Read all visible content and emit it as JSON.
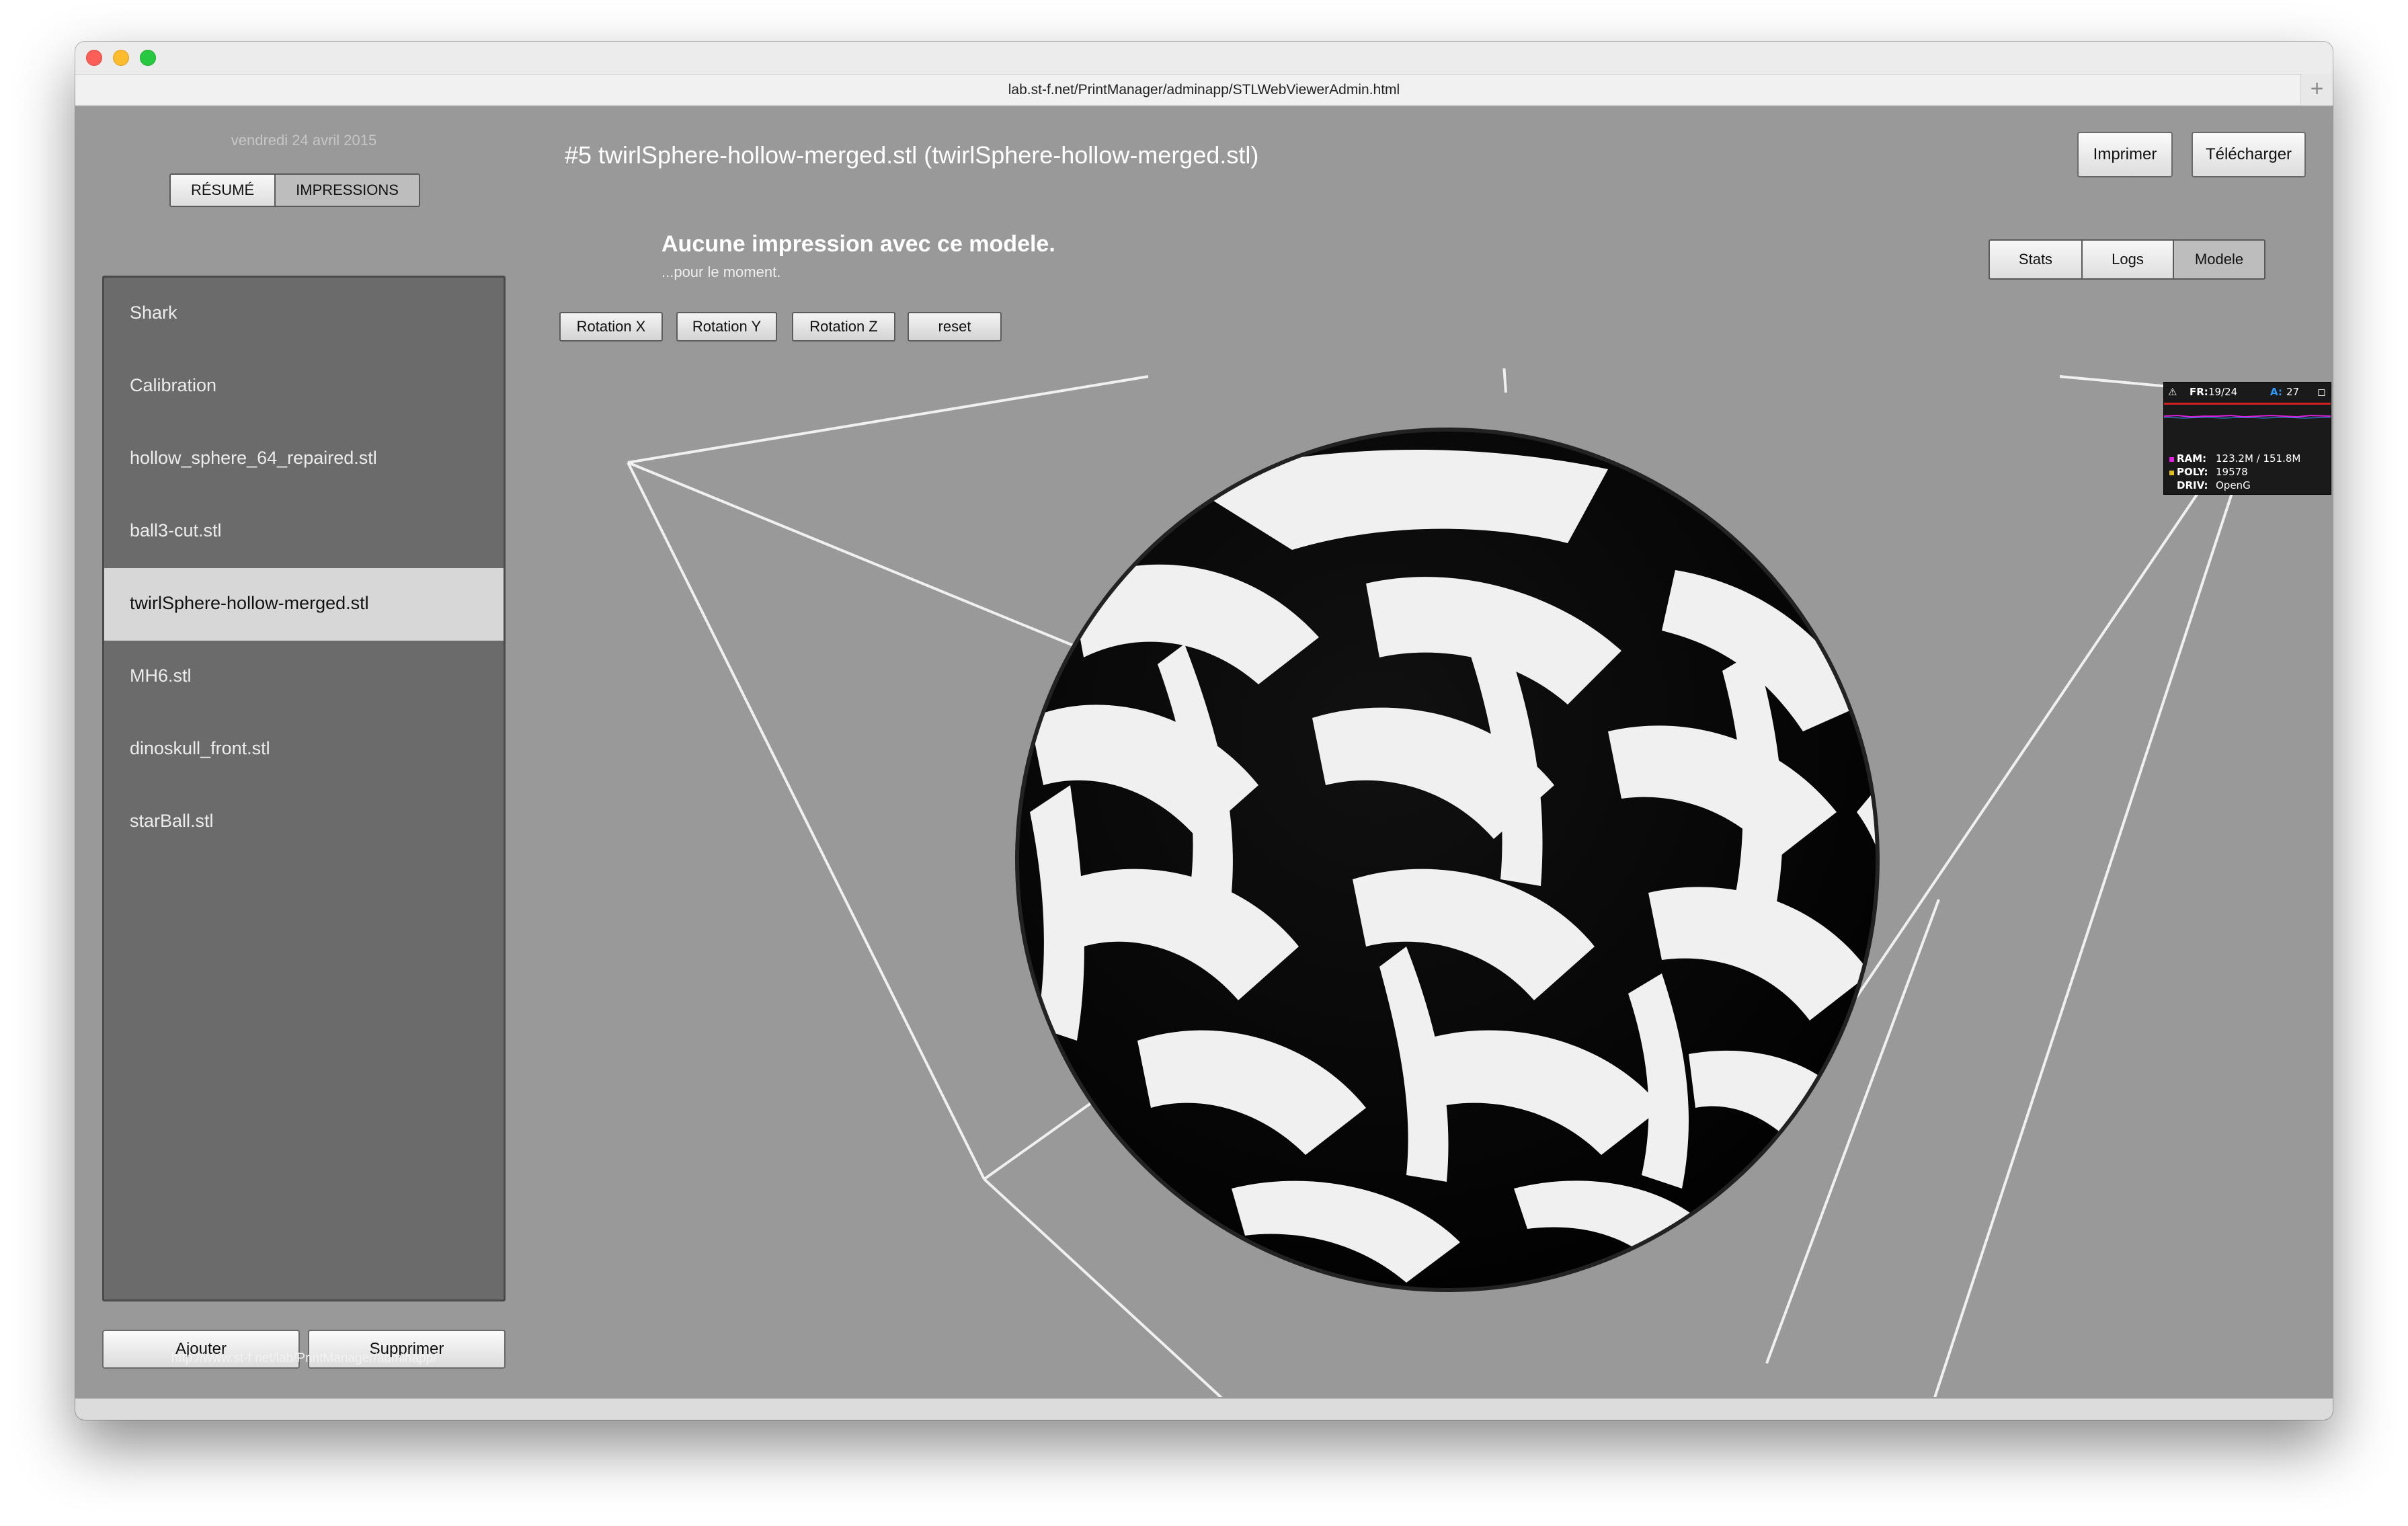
{
  "browser": {
    "url": "lab.st-f.net/PrintManager/adminapp/STLWebViewerAdmin.html",
    "new_tab_symbol": "+"
  },
  "sidebar": {
    "date": "vendredi 24 avril 2015",
    "tabs": [
      {
        "label": "RÉSUMÉ",
        "active": false
      },
      {
        "label": "IMPRESSIONS",
        "active": true
      }
    ],
    "items": [
      {
        "label": "Shark"
      },
      {
        "label": "Calibration"
      },
      {
        "label": "hollow_sphere_64_repaired.stl"
      },
      {
        "label": "ball3-cut.stl"
      },
      {
        "label": "twirlSphere-hollow-merged.stl",
        "selected": true
      },
      {
        "label": "MH6.stl"
      },
      {
        "label": "dinoskull_front.stl"
      },
      {
        "label": "starBall.stl"
      }
    ],
    "add_label": "Ajouter",
    "delete_label": "Supprimer",
    "footer_url": "http://www.st-f.net/lab/PrintManager/adminapp/"
  },
  "main": {
    "title": "#5 twirlSphere-hollow-merged.stl (twirlSphere-hollow-merged.stl)",
    "print_label": "Imprimer",
    "download_label": "Télécharger",
    "headline": "Aucune impression avec ce modele.",
    "subline": "...pour le moment.",
    "view_tabs": [
      {
        "label": "Stats",
        "active": false
      },
      {
        "label": "Logs",
        "active": false
      },
      {
        "label": "Modele",
        "active": true
      }
    ],
    "rotation_buttons": [
      "Rotation X",
      "Rotation Y",
      "Rotation Z",
      "reset"
    ]
  },
  "stats_panel": {
    "fr_label": "FR:",
    "fr_value": "19/24",
    "a_label": "A:",
    "a_value": "27",
    "ram_label": "RAM:",
    "ram_value": "123.2M / 151.8M",
    "poly_label": "POLY:",
    "poly_value": "19578",
    "driv_label": "DRIV:",
    "driv_value": "OpenG",
    "colors": {
      "fr": "#ffffff",
      "a": "#3399ff",
      "ram": "#e020e0",
      "poly": "#e0c020",
      "line": "#d02020"
    }
  },
  "colors": {
    "background": "#999999",
    "sidebar_list": "#6b6b6b",
    "selected_item": "#d7d7d7",
    "sphere_solid": "#f0f0f0",
    "sphere_shadow": "#050505"
  }
}
